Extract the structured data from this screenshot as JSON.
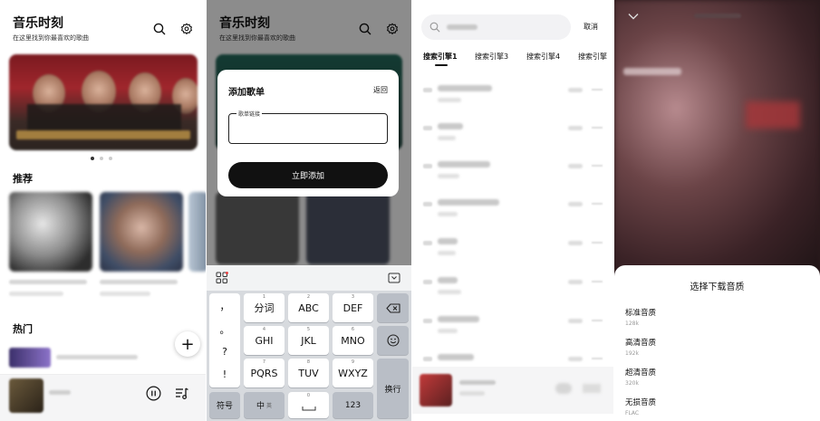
{
  "home": {
    "title": "音乐时刻",
    "subtitle": "在这里找到你最喜欢的歌曲",
    "section_recommend": "推荐",
    "section_hot": "热门",
    "fab_label": "+",
    "icons": [
      "search-icon",
      "gear-icon",
      "pause-icon",
      "playlist-icon"
    ]
  },
  "add_playlist": {
    "title": "音乐时刻",
    "subtitle": "在这里找到你最喜欢的歌曲",
    "dialog_title": "添加歌单",
    "back_label": "返回",
    "input_label": "歌单链接",
    "input_value": "",
    "submit_label": "立即添加"
  },
  "keyboard": {
    "punctuation": [
      "，",
      "。",
      "?",
      "!"
    ],
    "rows": [
      [
        {
          "num": "1",
          "label": "分词"
        },
        {
          "num": "2",
          "label": "ABC"
        },
        {
          "num": "3",
          "label": "DEF"
        }
      ],
      [
        {
          "num": "4",
          "label": "GHI"
        },
        {
          "num": "5",
          "label": "JKL"
        },
        {
          "num": "6",
          "label": "MNO"
        }
      ],
      [
        {
          "num": "7",
          "label": "PQRS"
        },
        {
          "num": "8",
          "label": "TUV"
        },
        {
          "num": "9",
          "label": "WXYZ"
        }
      ]
    ],
    "symbols_label": "符号",
    "lang_label": "中",
    "lang_sub": "英",
    "space_num": "0",
    "num_label": "123",
    "enter_label": "换行"
  },
  "search": {
    "cancel_label": "取消",
    "tabs": [
      "搜索引擎1",
      "搜索引擎3",
      "搜索引擎4",
      "搜索引擎"
    ],
    "active_tab": 0
  },
  "quality": {
    "sheet_title": "选择下载音质",
    "options": [
      {
        "name": "标准音质",
        "sub": "128k"
      },
      {
        "name": "高清音质",
        "sub": "192k"
      },
      {
        "name": "超清音质",
        "sub": "320k"
      },
      {
        "name": "无损音质",
        "sub": "FLAC"
      }
    ]
  },
  "colors": {
    "accent": "#111111",
    "dialog_overlay": "#000000",
    "keyboard_bg": "#d7dade"
  }
}
